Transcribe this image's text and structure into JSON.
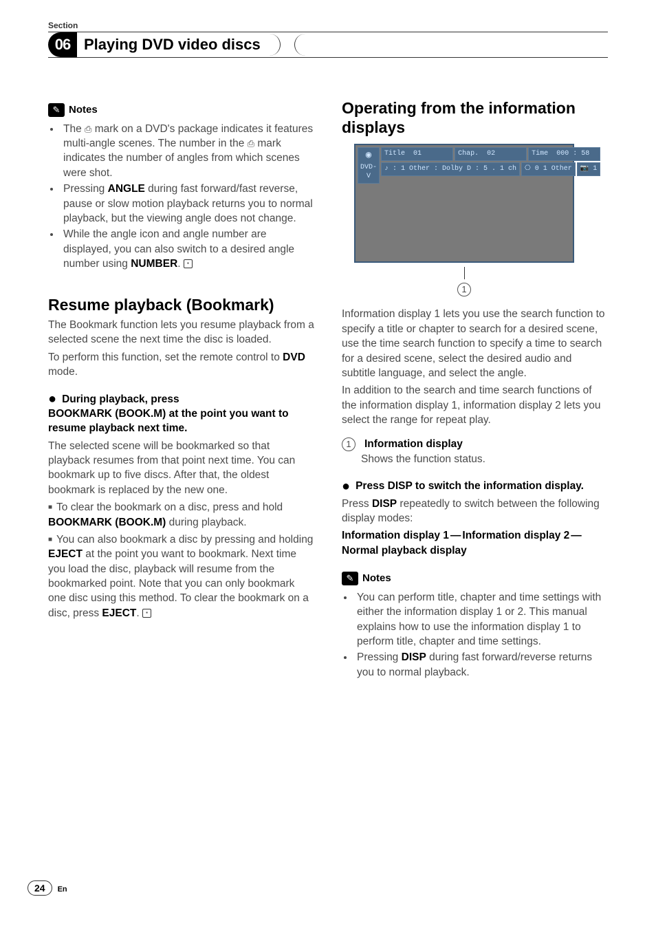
{
  "meta": {
    "section_label": "Section",
    "section_number": "06",
    "chapter_title": "Playing DVD video discs",
    "page_number": "24",
    "language": "En"
  },
  "left": {
    "notes_label": "Notes",
    "notes": [
      {
        "pre": "The ",
        "icon": "multi-angle-icon",
        "mid1": " mark on a DVD's package indicates it features multi-angle scenes. The number in the ",
        "mid2": " mark indicates the number of angles from which scenes were shot."
      },
      {
        "text_pre": "Pressing ",
        "bold": "ANGLE",
        "text_post": " during fast forward/fast reverse, pause or slow motion playback returns you to normal playback, but the viewing angle does not change."
      },
      {
        "text_pre": "While the angle icon and angle number are displayed, you can also switch to a desired angle number using ",
        "bold": "NUMBER",
        "end": true
      }
    ],
    "resume_h": "Resume playback (Bookmark)",
    "resume_p1": "The Bookmark function lets you resume playback from a selected scene the next time the disc is loaded.",
    "resume_p2_pre": "To perform this function, set the remote control to ",
    "resume_p2_bold": "DVD",
    "resume_p2_post": " mode.",
    "step1_line1": "During playback, press",
    "step1_line2": "BOOKMARK (BOOK.M) at the point you want to resume playback next time.",
    "step1_body": "The selected scene will be bookmarked so that playback resumes from that point next time. You can bookmark up to five discs. After that, the oldest bookmark is replaced by the new one.",
    "sub1_pre": "To clear the bookmark on a disc, press and hold ",
    "sub1_bold": "BOOKMARK (BOOK.M)",
    "sub1_post": " during playback.",
    "sub2_pre": "You can also bookmark a disc by pressing and holding ",
    "sub2_bold1": "EJECT",
    "sub2_mid": " at the point you want to bookmark. Next time you load the disc, playback will resume from the bookmarked point. Note that you can only bookmark one disc using this method. To clear the bookmark on a disc, press ",
    "sub2_bold2": "EJECT",
    "sub2_end": true
  },
  "right": {
    "heading": "Operating from the information displays",
    "display": {
      "dvdv": "DVD-V",
      "title_lbl": "Title",
      "title_val": "01",
      "chap_lbl": "Chap.",
      "chap_val": "02",
      "time_lbl": "Time",
      "time_val": "000 : 58",
      "row2a": "♪ : 1 Other : Dolby D : 5 . 1 ch",
      "row2b": "⎔ 0 1 Other",
      "row2c": "📷 1"
    },
    "callout1": "1",
    "para1": "Information display 1 lets you use the search function to specify a title or chapter to search for a desired scene, use the time search function to specify a time to search for a desired scene, select the desired audio and subtitle language, and select the angle.",
    "para2": "In addition to the search and time search functions of the information display 1, information display 2 lets you select the range for repeat play.",
    "item_num": "1",
    "item_label": "Information display",
    "item_desc": "Shows the function status.",
    "step2_head": "Press DISP to switch the information display.",
    "step2_body_pre": "Press ",
    "step2_body_bold": "DISP",
    "step2_body_post": " repeatedly to switch between the following display modes:",
    "modes_1": "Information display 1",
    "modes_2": "Information display 2",
    "modes_3": "Normal playback display",
    "notes_label": "Notes",
    "note_a": "You can perform title, chapter and time settings with either the information display 1 or 2. This manual explains how to use the information display 1 to perform title, chapter and time settings.",
    "note_b_pre": "Pressing ",
    "note_b_bold": "DISP",
    "note_b_post": " during fast forward/reverse returns you to normal playback."
  }
}
